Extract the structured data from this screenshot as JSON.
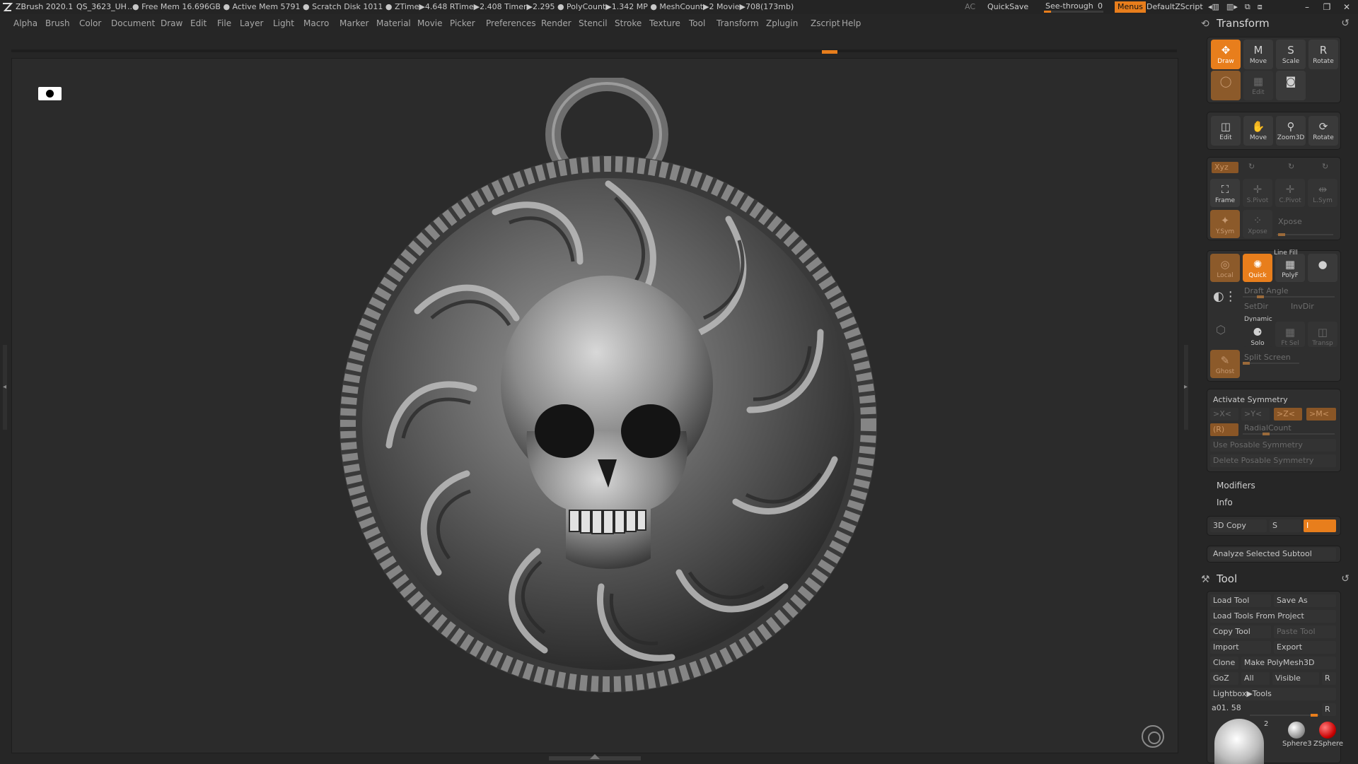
{
  "titlebar": {
    "app": "ZBrush 2020.1",
    "document": "QS_3623_UH",
    "stats": "..● Free Mem 16.696GB ● Active Mem 5791 ● Scratch Disk 1011 ● ZTime▶4.648 RTime▶2.408 Timer▶2.295 ● PolyCount▶1.342 MP ● MeshCount▶2 Movie▶708(173mb)",
    "ac": "AC",
    "quicksave": "QuickSave",
    "seethrough_label": "See-through",
    "seethrough_value": "0",
    "seethrough_level": 0,
    "menus": "Menus",
    "script": "DefaultZScript"
  },
  "menubar": [
    "Alpha",
    "Brush",
    "Color",
    "Document",
    "Draw",
    "Edit",
    "File",
    "Layer",
    "Light",
    "Macro",
    "Marker",
    "Material",
    "Movie",
    "Picker",
    "Preferences",
    "Render",
    "Stencil",
    "Stroke",
    "Texture",
    "Tool",
    "Transform",
    "Zplugin",
    "Zscript",
    "Help"
  ],
  "transform": {
    "title": "Transform",
    "row1": [
      {
        "label": "Draw",
        "icon": "✥",
        "state": "on"
      },
      {
        "label": "Move",
        "icon": "M",
        "state": ""
      },
      {
        "label": "Scale",
        "icon": "S",
        "state": ""
      },
      {
        "label": "Rotate",
        "icon": "R",
        "state": ""
      }
    ],
    "row2": [
      {
        "label": "",
        "icon": "◯",
        "state": "dimorange"
      },
      {
        "label": "Edit",
        "icon": "▦",
        "state": "dim"
      },
      {
        "label": "",
        "icon": "◙",
        "state": ""
      }
    ],
    "row3": [
      {
        "label": "Edit",
        "icon": "◫",
        "state": ""
      },
      {
        "label": "Move",
        "icon": "✋",
        "state": ""
      },
      {
        "label": "Zoom3D",
        "icon": "⚲",
        "state": ""
      },
      {
        "label": "Rotate",
        "icon": "⟳",
        "state": ""
      }
    ],
    "xyz": "Xyz",
    "frame": "Frame",
    "spivot": "S.Pivot",
    "cpivot": "C.Pivot",
    "lsym": "L.Sym",
    "ysym": "Y.Sym",
    "xpose_btn": "Xpose",
    "xpose": "Xpose",
    "local": "Local",
    "quick": "Quick",
    "linefill": "Line Fill",
    "polyf": "PolyF",
    "draft_angle": "Draft Angle",
    "setdir": "SetDir",
    "invdir": "InvDir",
    "dynamic": "Dynamic",
    "solo": "Solo",
    "ftsel": "Ft Sel",
    "transp": "Transp",
    "ghost": "Ghost",
    "split_screen": "Split Screen",
    "activate_symmetry": "Activate Symmetry",
    "sym_x": ">X<",
    "sym_y": ">Y<",
    "sym_z": ">Z<",
    "sym_m": ">M<",
    "sym_r": "(R)",
    "radial_count": "RadialCount",
    "use_posable": "Use Posable Symmetry",
    "delete_posable": "Delete Posable Symmetry",
    "modifiers": "Modifiers",
    "info": "Info",
    "copy3d": "3D Copy",
    "copy3d_s": "S",
    "copy3d_i": "I",
    "analyze": "Analyze Selected Subtool"
  },
  "tool": {
    "title": "Tool",
    "load_tool": "Load Tool",
    "save_as": "Save As",
    "load_from_project": "Load Tools From Project",
    "copy_tool": "Copy Tool",
    "paste_tool": "Paste Tool",
    "import": "Import",
    "export": "Export",
    "clone": "Clone",
    "make_polymesh": "Make PolyMesh3D",
    "goz": "GoZ",
    "all": "All",
    "visible": "Visible",
    "r": "R",
    "lightbox_tools": "Lightbox▶Tools",
    "current_tool": "a01. 58",
    "current_r": "R",
    "thumb_count": "2",
    "thumbs": [
      "Sphere3",
      "ZSphere"
    ]
  },
  "colors": {
    "accent": "#e87e1c",
    "panel": "#2f2f2f",
    "canvas": "#2b2b2b"
  }
}
